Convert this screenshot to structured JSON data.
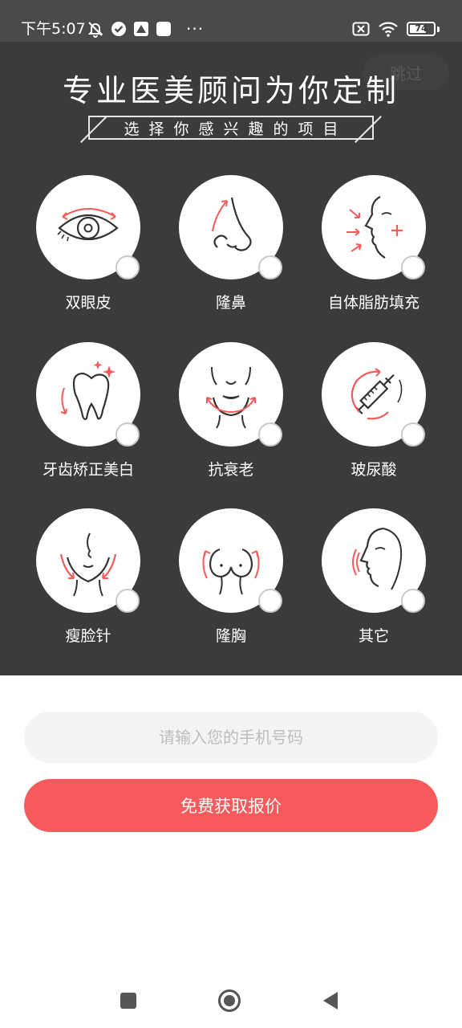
{
  "status_bar": {
    "time": "下午5:07",
    "dots": "···",
    "battery_level": "74",
    "battery_percent": 74
  },
  "header": {
    "skip_label": "跳过",
    "title": "专业医美顾问为你定制",
    "subtitle": "选择你感兴趣的项目"
  },
  "items": [
    {
      "label": "双眼皮",
      "icon": "eye-icon"
    },
    {
      "label": "隆鼻",
      "icon": "nose-icon"
    },
    {
      "label": "自体脂肪填充",
      "icon": "face-fill-icon"
    },
    {
      "label": "牙齿矫正美白",
      "icon": "tooth-icon"
    },
    {
      "label": "抗衰老",
      "icon": "anti-aging-face-icon"
    },
    {
      "label": "玻尿酸",
      "icon": "syringe-icon"
    },
    {
      "label": "瘦脸针",
      "icon": "slim-face-icon"
    },
    {
      "label": "隆胸",
      "icon": "chest-icon"
    },
    {
      "label": "其它",
      "icon": "face-profile-icon"
    }
  ],
  "form": {
    "phone_placeholder": "请输入您的手机号码",
    "submit_label": "免费获取报价"
  },
  "colors": {
    "accent": "#f65a5a",
    "panel": "#3b3b3b",
    "line_art": "#333333"
  }
}
